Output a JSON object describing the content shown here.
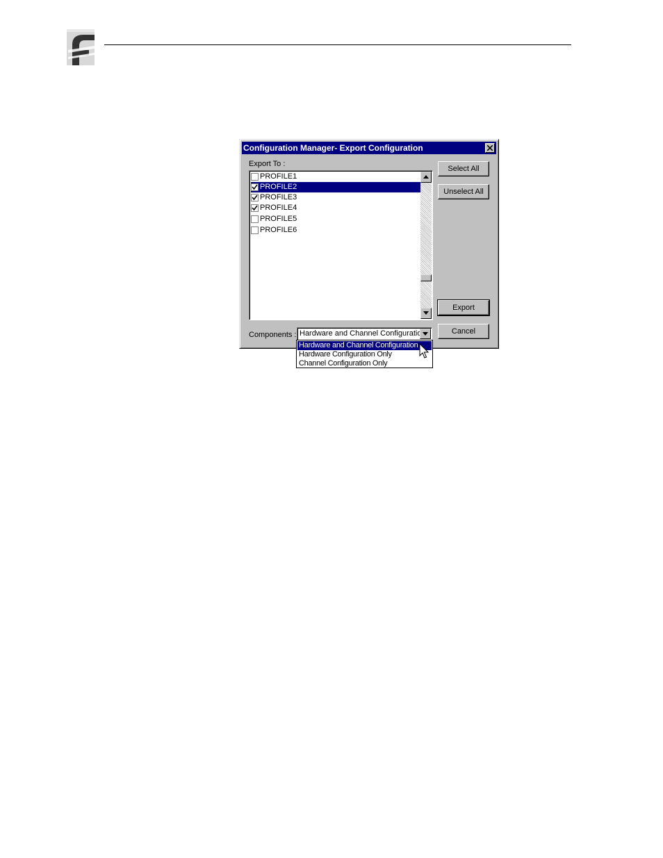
{
  "dialog": {
    "title": "Configuration Manager- Export Configuration",
    "export_label": "Export To :",
    "profiles": [
      {
        "label": "PROFILE1",
        "checked": false,
        "selected": false
      },
      {
        "label": "PROFILE2",
        "checked": true,
        "selected": true
      },
      {
        "label": "PROFILE3",
        "checked": true,
        "selected": false
      },
      {
        "label": "PROFILE4",
        "checked": true,
        "selected": false
      },
      {
        "label": "PROFILE5",
        "checked": false,
        "selected": false
      },
      {
        "label": "PROFILE6",
        "checked": false,
        "selected": false
      }
    ],
    "buttons": {
      "select_all": "Select All",
      "unselect_all": "Unselect All",
      "export": "Export",
      "cancel": "Cancel"
    },
    "components_label": "Components :",
    "components_value": "Hardware and Channel Configuration",
    "components_options": [
      "Hardware and Channel Configuration",
      "Hardware Configuration Only",
      "Channel Configuration Only"
    ],
    "highlighted_option": 0
  },
  "colors": {
    "titlebar": "#000080",
    "dialog_face": "#c0c0c0",
    "selection": "#000080"
  },
  "icons": [
    "company-logo-icon",
    "close-icon",
    "scroll-up-arrow-icon",
    "scroll-down-arrow-icon",
    "dropdown-arrow-icon",
    "checkmark-icon",
    "mouse-pointer-icon"
  ]
}
